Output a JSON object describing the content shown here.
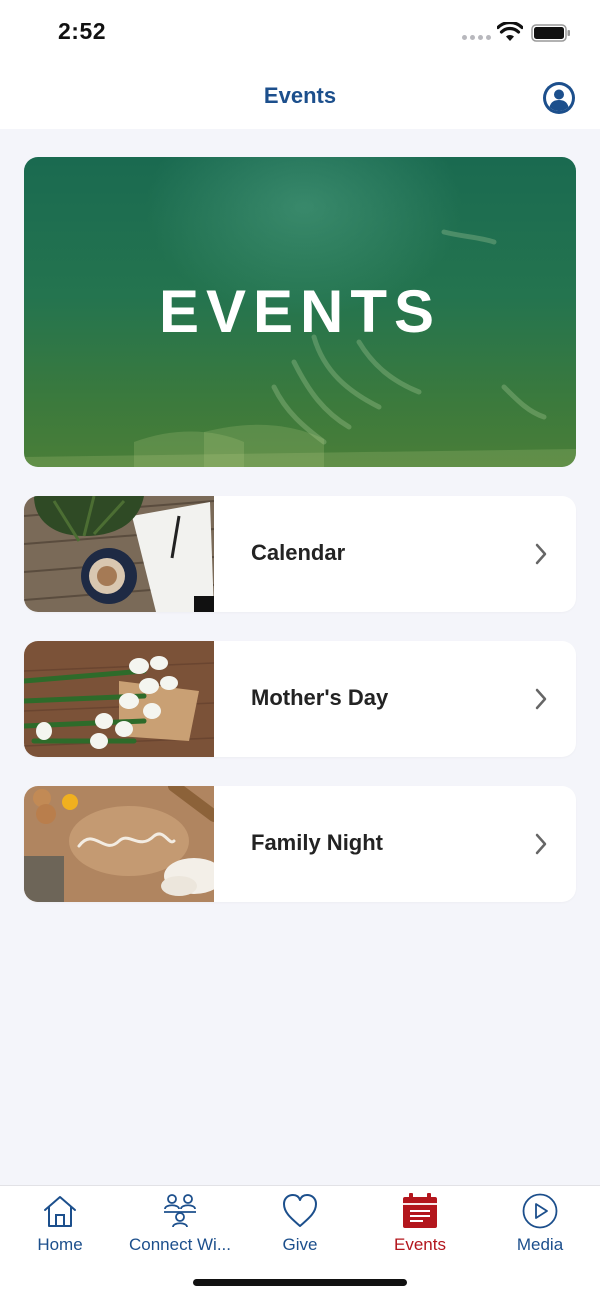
{
  "status_bar": {
    "time": "2:52"
  },
  "nav": {
    "title": "Events"
  },
  "hero": {
    "title": "EVENTS"
  },
  "events": [
    {
      "label": "Calendar",
      "thumb": "notebook-coffee-photo"
    },
    {
      "label": "Mother's Day",
      "thumb": "tulips-photo"
    },
    {
      "label": "Family Night",
      "thumb": "flour-family-photo"
    }
  ],
  "tabs": [
    {
      "label": "Home",
      "icon": "home-icon"
    },
    {
      "label": "Connect Wi...",
      "icon": "people-icon"
    },
    {
      "label": "Give",
      "icon": "heart-icon"
    },
    {
      "label": "Events",
      "icon": "calendar-icon",
      "active": true
    },
    {
      "label": "Media",
      "icon": "play-icon"
    }
  ],
  "colors": {
    "accent": "#1c4f8c",
    "active": "#b3161d",
    "background": "#f4f5fa",
    "hero": "#24744f"
  }
}
